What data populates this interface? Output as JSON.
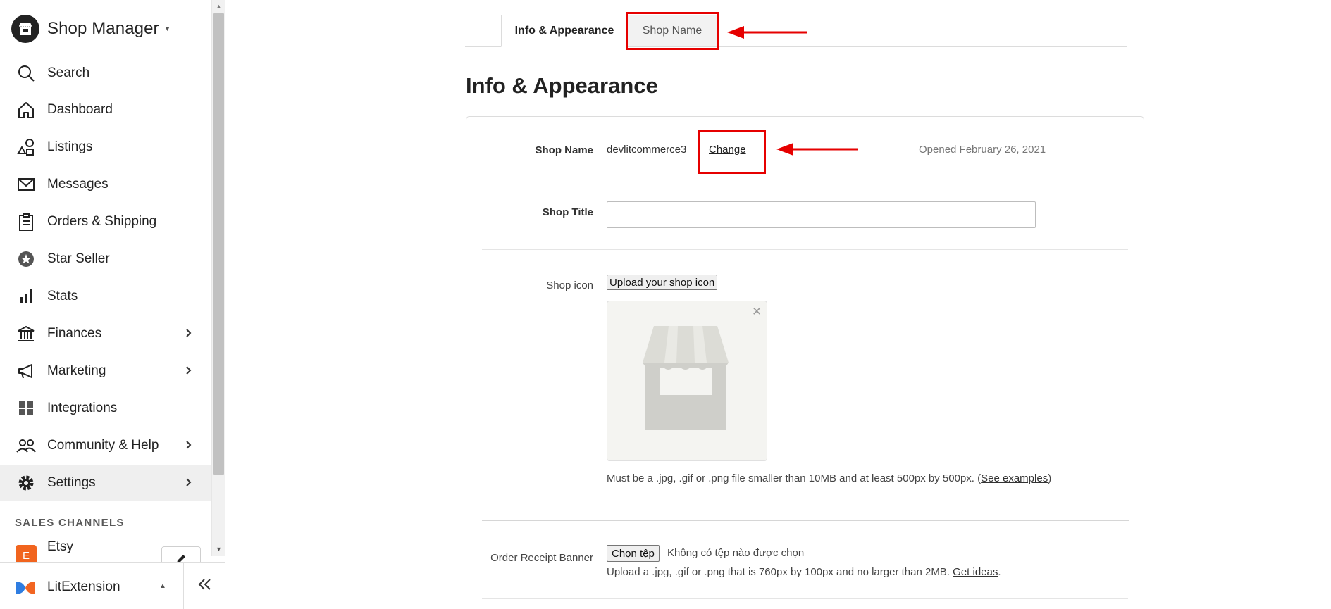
{
  "sidebar": {
    "title": "Shop Manager",
    "nav": [
      {
        "label": "Search",
        "icon": "search-icon"
      },
      {
        "label": "Dashboard",
        "icon": "home-icon"
      },
      {
        "label": "Listings",
        "icon": "listings-icon"
      },
      {
        "label": "Messages",
        "icon": "envelope-icon"
      },
      {
        "label": "Orders & Shipping",
        "icon": "clipboard-icon"
      },
      {
        "label": "Star Seller",
        "icon": "star-badge-icon"
      },
      {
        "label": "Stats",
        "icon": "bar-chart-icon"
      },
      {
        "label": "Finances",
        "icon": "bank-icon"
      },
      {
        "label": "Marketing",
        "icon": "megaphone-icon"
      },
      {
        "label": "Integrations",
        "icon": "grid-icon"
      },
      {
        "label": "Community & Help",
        "icon": "people-icon"
      },
      {
        "label": "Settings",
        "icon": "gear-icon"
      }
    ],
    "sales_channels_heading": "SALES CHANNELS",
    "etsy_label": "Etsy",
    "etsy_badge": "E",
    "footer_label": "LitExtension"
  },
  "tabs": {
    "info": "Info & Appearance",
    "shop_name": "Shop Name"
  },
  "page": {
    "title": "Info & Appearance"
  },
  "form": {
    "shop_name_label": "Shop Name",
    "shop_name_value": "devlitcommerce3",
    "change_link": "Change",
    "opened": "Opened February 26, 2021",
    "shop_title_label": "Shop Title",
    "shop_title_value": "",
    "shop_icon_label": "Shop icon",
    "upload_button": "Upload your shop icon",
    "icon_help": "Must be a .jpg, .gif or .png file smaller than 10MB and at least 500px by 500px. (",
    "icon_help_link": "See examples",
    "icon_help_end": ")",
    "banner_label": "Order Receipt Banner",
    "choose_file": "Chọn tệp",
    "no_file": "Không có tệp nào được chọn",
    "banner_help": "Upload a .jpg, .gif or .png that is 760px by 100px and no larger than 2MB.",
    "banner_help_link": "Get ideas",
    "banner_help_end": "."
  },
  "colors": {
    "highlight": "#e60000",
    "etsy_orange": "#f1641e"
  }
}
